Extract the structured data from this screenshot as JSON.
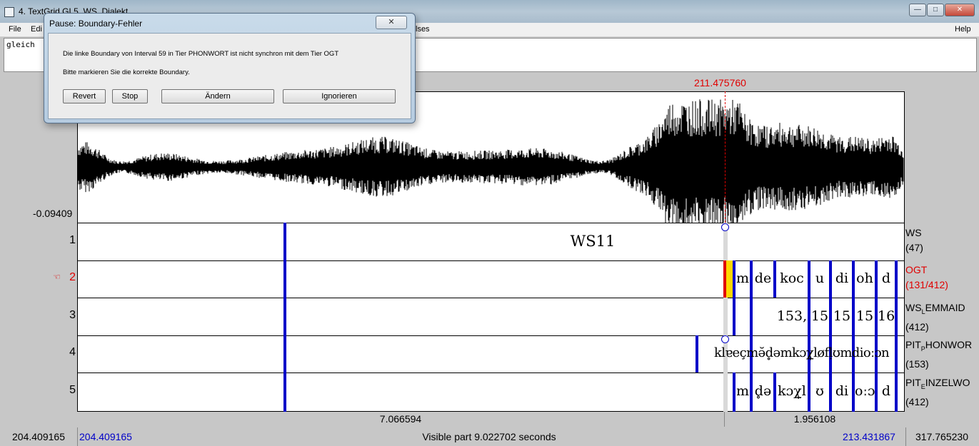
{
  "window": {
    "title": "4. TextGrid GL5_WS_Dialekt",
    "min_label": "—",
    "max_label": "□",
    "close_label": "✕"
  },
  "menu": {
    "file": "File",
    "edit": "Edi",
    "hidden_tail": "lses",
    "help": "Help"
  },
  "text_area": {
    "content": "gleich"
  },
  "editor": {
    "cursor_time": "211.475760",
    "wave_min": "-0.09409",
    "tiers": [
      {
        "number": "1",
        "name": "WS",
        "count": "(47)",
        "labels": [
          "WS11"
        ]
      },
      {
        "number": "2",
        "name": "OGT",
        "count": "(131/412)",
        "labels": [
          "m",
          "de",
          "koc",
          "u",
          "di",
          "oh",
          "d"
        ]
      },
      {
        "number": "3",
        "name": "WS_LEMMAID",
        "name_main": "WS",
        "name_sub": "L",
        "name_rest": "EMMAID",
        "count": "(412)",
        "labels": [
          "153,",
          "15",
          "15",
          "15",
          "16"
        ]
      },
      {
        "number": "4",
        "name": "PIT_PHONWOR",
        "name_main": "PIT",
        "name_sub": "P",
        "name_rest": "HONWOR",
        "count": "(153)",
        "labels": [
          "klɐeçmə̆d̥əmkɔχ̞løfḷʊmdioːɔn"
        ]
      },
      {
        "number": "5",
        "name": "PIT_EINZELWO",
        "name_main": "PIT",
        "name_sub": "E",
        "name_rest": "INZELWO",
        "count": "(412)",
        "labels": [
          "m",
          "d̥ə",
          "kɔχ̞l",
          "ʊ",
          "di",
          "oːɔ",
          "d"
        ]
      }
    ],
    "selected_tier_marker": "☜",
    "segment_left": "7.066594",
    "segment_right": "1.956108"
  },
  "status": {
    "total_start": "204.409165",
    "visible_start": "204.409165",
    "visible_text": "Visible part 9.022702 seconds",
    "visible_end": "213.431867",
    "total_end": "317.765230"
  },
  "dialog": {
    "title": "Pause: Boundary-Fehler",
    "close": "✕",
    "message1": "Die linke Boundary von Interval 59 in Tier PHONWORT ist nicht synchron mit dem Tier OGT",
    "message2": "Bitte markieren Sie die korrekte Boundary.",
    "buttons": {
      "revert": "Revert",
      "stop": "Stop",
      "change": "Ändern",
      "ignore": "Ignorieren"
    }
  },
  "colors": {
    "boundary": "#0000c8",
    "cursor": "#e00000",
    "interval_highlight": "#ffd700"
  }
}
